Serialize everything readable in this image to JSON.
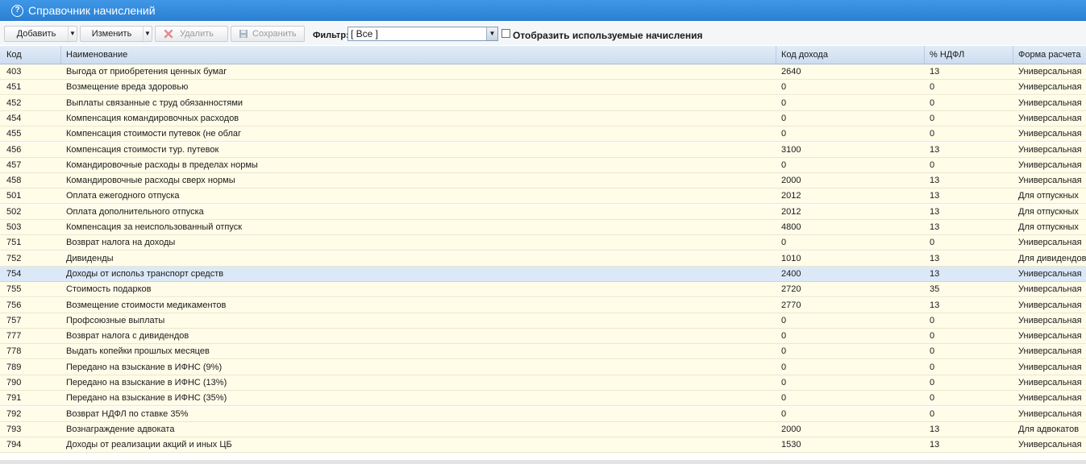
{
  "window": {
    "title": "Справочник начислений"
  },
  "toolbar": {
    "add_label": "Добавить",
    "edit_label": "Изменить",
    "delete_label": "Удалить",
    "save_label": "Сохранить",
    "filter_label": "Фильтр:",
    "filter_value": "[ Все ]",
    "show_used_label": "Отобразить используемые начисления",
    "show_used_checked": false
  },
  "table": {
    "columns": [
      "Код",
      "Наименование",
      "Код дохода",
      "% НДФЛ",
      "Форма расчета"
    ],
    "selected_row_index": 13,
    "rows": [
      [
        "403",
        "Выгода от приобретения ценных бумаг",
        "2640",
        "13",
        "Универсальная"
      ],
      [
        "451",
        "Возмещение вреда здоровью",
        "0",
        "0",
        "Универсальная"
      ],
      [
        "452",
        "Выплаты связанные с труд обязанностями",
        "0",
        "0",
        "Универсальная"
      ],
      [
        "454",
        "Компенсация командировочных расходов",
        "0",
        "0",
        "Универсальная"
      ],
      [
        "455",
        "Компенсация стоимости путевок (не облаг",
        "0",
        "0",
        "Универсальная"
      ],
      [
        "456",
        "Компенсация стоимости тур. путевок",
        "3100",
        "13",
        "Универсальная"
      ],
      [
        "457",
        "Командировочные расходы в пределах нормы",
        "0",
        "0",
        "Универсальная"
      ],
      [
        "458",
        "Командировочные расходы сверх нормы",
        "2000",
        "13",
        "Универсальная"
      ],
      [
        "501",
        "Оплата ежегодного отпуска",
        "2012",
        "13",
        "Для отпускных"
      ],
      [
        "502",
        "Оплата дополнительного отпуска",
        "2012",
        "13",
        "Для отпускных"
      ],
      [
        "503",
        "Компенсация за неиспользованный отпуск",
        "4800",
        "13",
        "Для отпускных"
      ],
      [
        "751",
        "Возврат налога на доходы",
        "0",
        "0",
        "Универсальная"
      ],
      [
        "752",
        "Дивиденды",
        "1010",
        "13",
        "Для дивидендов"
      ],
      [
        "754",
        "Доходы от использ транспорт средств",
        "2400",
        "13",
        "Универсальная"
      ],
      [
        "755",
        "Стоимость подарков",
        "2720",
        "35",
        "Универсальная"
      ],
      [
        "756",
        "Возмещение стоимости медикаментов",
        "2770",
        "13",
        "Универсальная"
      ],
      [
        "757",
        "Профсоюзные выплаты",
        "0",
        "0",
        "Универсальная"
      ],
      [
        "777",
        "Возврат налога с дивидендов",
        "0",
        "0",
        "Универсальная"
      ],
      [
        "778",
        "Выдать копейки прошлых месяцев",
        "0",
        "0",
        "Универсальная"
      ],
      [
        "789",
        "Передано на взыскание в ИФНС (9%)",
        "0",
        "0",
        "Универсальная"
      ],
      [
        "790",
        "Передано на взыскание в ИФНС (13%)",
        "0",
        "0",
        "Универсальная"
      ],
      [
        "791",
        "Передано на взыскание в ИФНС (35%)",
        "0",
        "0",
        "Универсальная"
      ],
      [
        "792",
        "Возврат НДФЛ по ставке 35%",
        "0",
        "0",
        "Универсальная"
      ],
      [
        "793",
        "Вознаграждение адвоката",
        "2000",
        "13",
        "Для адвокатов"
      ],
      [
        "794",
        "Доходы от реализации акций и иных ЦБ",
        "1530",
        "13",
        "Универсальная"
      ]
    ]
  }
}
